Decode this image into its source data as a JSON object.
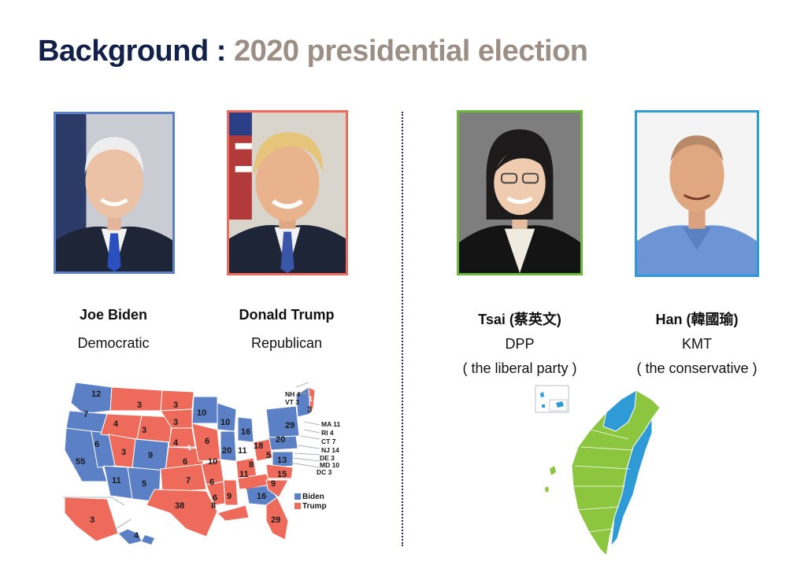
{
  "title": {
    "prefix": "Background : ",
    "main": "2020 presidential election"
  },
  "colors": {
    "title_dark": "#12204a",
    "title_grey": "#9b8e84",
    "democrat_blue": "#5b80c6",
    "republican_red": "#ee6a5a",
    "dpp_green": "#8cc63e",
    "kmt_blue": "#2e9ad6"
  },
  "candidates": [
    {
      "name": "Joe Biden",
      "party": "Democratic",
      "note": "",
      "frame_color": "#5b80c6"
    },
    {
      "name": "Donald Trump",
      "party": "Republican",
      "note": "",
      "frame_color": "#ee6a5a"
    },
    {
      "name": "Tsai (蔡英文)",
      "party": "DPP",
      "note": "( the liberal party )",
      "frame_color": "#6cb83a"
    },
    {
      "name": "Han (韓國瑜)",
      "party": "KMT",
      "note": "( the conservative )",
      "frame_color": "#2e9ad6"
    }
  ],
  "us_map": {
    "legend": [
      "Biden",
      "Trump"
    ],
    "state_votes": [
      "12",
      "7",
      "6",
      "55",
      "3",
      "4",
      "3",
      "3",
      "3",
      "3",
      "10",
      "10",
      "6",
      "9",
      "11",
      "5",
      "7",
      "38",
      "1",
      "4",
      "6",
      "10",
      "6",
      "20",
      "11",
      "16",
      "29",
      "20",
      "18",
      "5",
      "13",
      "11",
      "8",
      "15",
      "6",
      "9",
      "9",
      "16",
      "29",
      "3",
      "4",
      "8",
      "3",
      "1"
    ],
    "callouts": [
      "NH 4",
      "VT 3",
      "MA 11",
      "RI 4",
      "CT 7",
      "NJ 14",
      "DE 3",
      "MD 10",
      "DC 3"
    ]
  }
}
